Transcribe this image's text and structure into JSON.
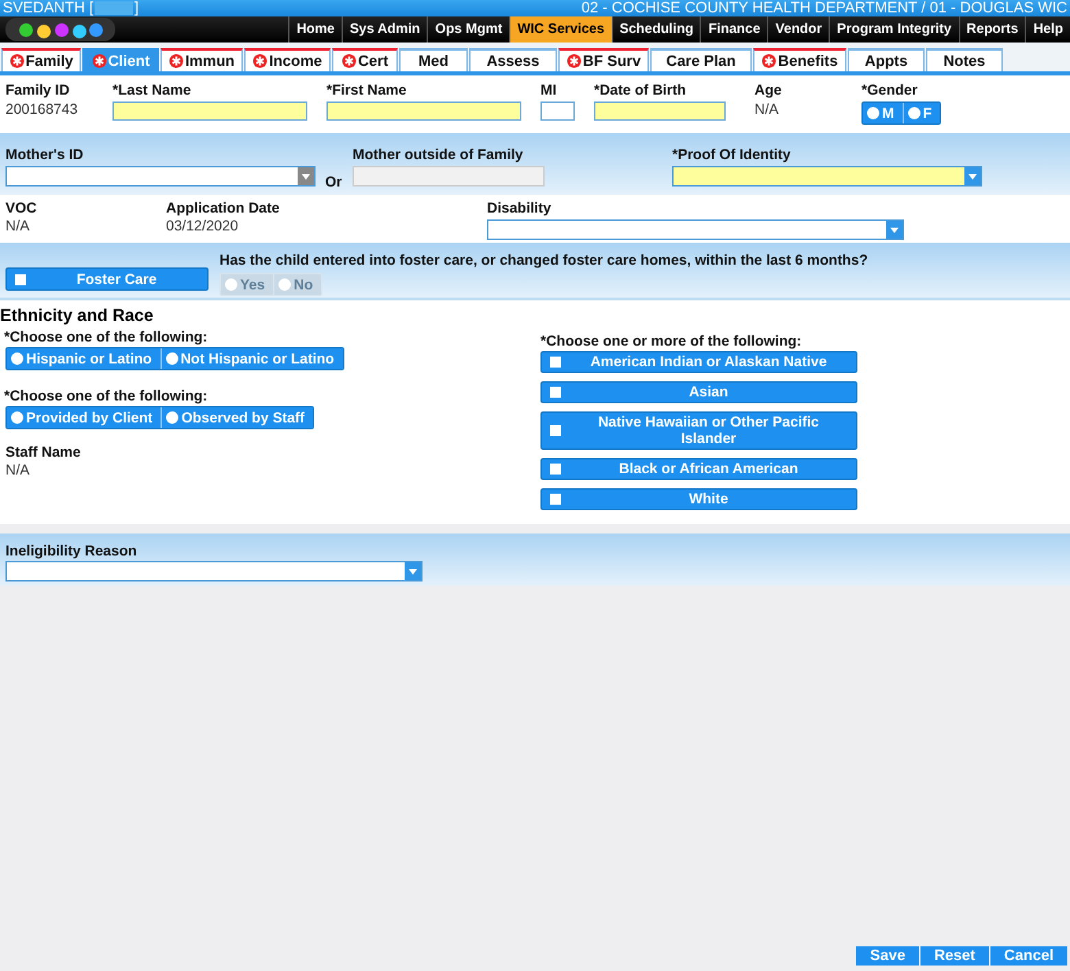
{
  "header": {
    "user": "SVEDANTH [",
    "user_end": "]",
    "location": "02 - COCHISE COUNTY HEALTH DEPARTMENT / 01 - DOUGLAS WIC"
  },
  "nav": [
    {
      "label": "Home",
      "selected": false
    },
    {
      "label": "Sys Admin",
      "selected": false
    },
    {
      "label": "Ops Mgmt",
      "selected": false
    },
    {
      "label": "WIC Services",
      "selected": true
    },
    {
      "label": "Scheduling",
      "selected": false
    },
    {
      "label": "Finance",
      "selected": false
    },
    {
      "label": "Vendor",
      "selected": false
    },
    {
      "label": "Program Integrity",
      "selected": false
    },
    {
      "label": "Reports",
      "selected": false
    },
    {
      "label": "Help",
      "selected": false
    }
  ],
  "tabs": [
    {
      "label": "Family",
      "required": true,
      "selected": false
    },
    {
      "label": "Client",
      "required": true,
      "selected": true
    },
    {
      "label": "Immun",
      "required": true,
      "selected": false
    },
    {
      "label": "Income",
      "required": true,
      "selected": false
    },
    {
      "label": "Cert",
      "required": true,
      "selected": false
    },
    {
      "label": "Med",
      "required": false,
      "selected": false
    },
    {
      "label": "Assess",
      "required": false,
      "selected": false
    },
    {
      "label": "BF Surv",
      "required": true,
      "selected": false
    },
    {
      "label": "Care Plan",
      "required": false,
      "selected": false
    },
    {
      "label": "Benefits",
      "required": true,
      "selected": false
    },
    {
      "label": "Appts",
      "required": false,
      "selected": false
    },
    {
      "label": "Notes",
      "required": false,
      "selected": false
    }
  ],
  "family_id": {
    "label": "Family ID",
    "value": "200168743"
  },
  "last_name": {
    "label": "*Last Name",
    "required": true
  },
  "first_name": {
    "label": "*First Name",
    "required": true
  },
  "mi": {
    "label": "MI",
    "required": false
  },
  "dob": {
    "label": "*Date of Birth",
    "required": true
  },
  "age": {
    "label": "Age",
    "value": "N/A"
  },
  "gender": {
    "label": "*Gender",
    "options": [
      {
        "label": "M",
        "selected": false
      },
      {
        "label": "F",
        "selected": false
      }
    ]
  },
  "mothers_id": {
    "label": "Mother's ID"
  },
  "or_label": "Or",
  "mother_outside": {
    "label": "Mother outside of Family",
    "disabled": true
  },
  "proof_of_identity": {
    "label": "*Proof Of Identity",
    "required": true
  },
  "voc": {
    "label": "VOC",
    "value": "N/A"
  },
  "application_date": {
    "label": "Application Date",
    "value": "03/12/2020"
  },
  "disability": {
    "label": "Disability",
    "required": false
  },
  "foster_care": {
    "label": "Foster Care",
    "checked": false,
    "question": "Has the child entered into foster care, or changed foster care homes, within the last 6 months?",
    "options": [
      {
        "label": "Yes",
        "selected": false,
        "disabled": true
      },
      {
        "label": "No",
        "selected": false,
        "disabled": true
      }
    ]
  },
  "ethnicity": {
    "title": "Ethnicity and Race",
    "ethnicity_prompt": "*Choose one of the following:",
    "ethnicity_options": [
      {
        "label": "Hispanic or Latino",
        "selected": false
      },
      {
        "label": "Not Hispanic or Latino",
        "selected": false
      }
    ],
    "source_prompt": "*Choose one of the following:",
    "source_options": [
      {
        "label": "Provided by Client",
        "selected": false
      },
      {
        "label": "Observed by Staff",
        "selected": false
      }
    ],
    "staff_name": {
      "label": "Staff Name",
      "value": "N/A"
    },
    "race_prompt": "*Choose one or more of the following:",
    "race_options": [
      {
        "label": "American Indian or Alaskan Native",
        "checked": false
      },
      {
        "label": "Asian",
        "checked": false
      },
      {
        "label": "Native Hawaiian or Other Pacific Islander",
        "checked": false
      },
      {
        "label": "Black or African American",
        "checked": false
      },
      {
        "label": "White",
        "checked": false
      }
    ]
  },
  "ineligibility": {
    "label": "Ineligibility Reason"
  },
  "buttons": [
    "Save",
    "Reset",
    "Cancel"
  ]
}
